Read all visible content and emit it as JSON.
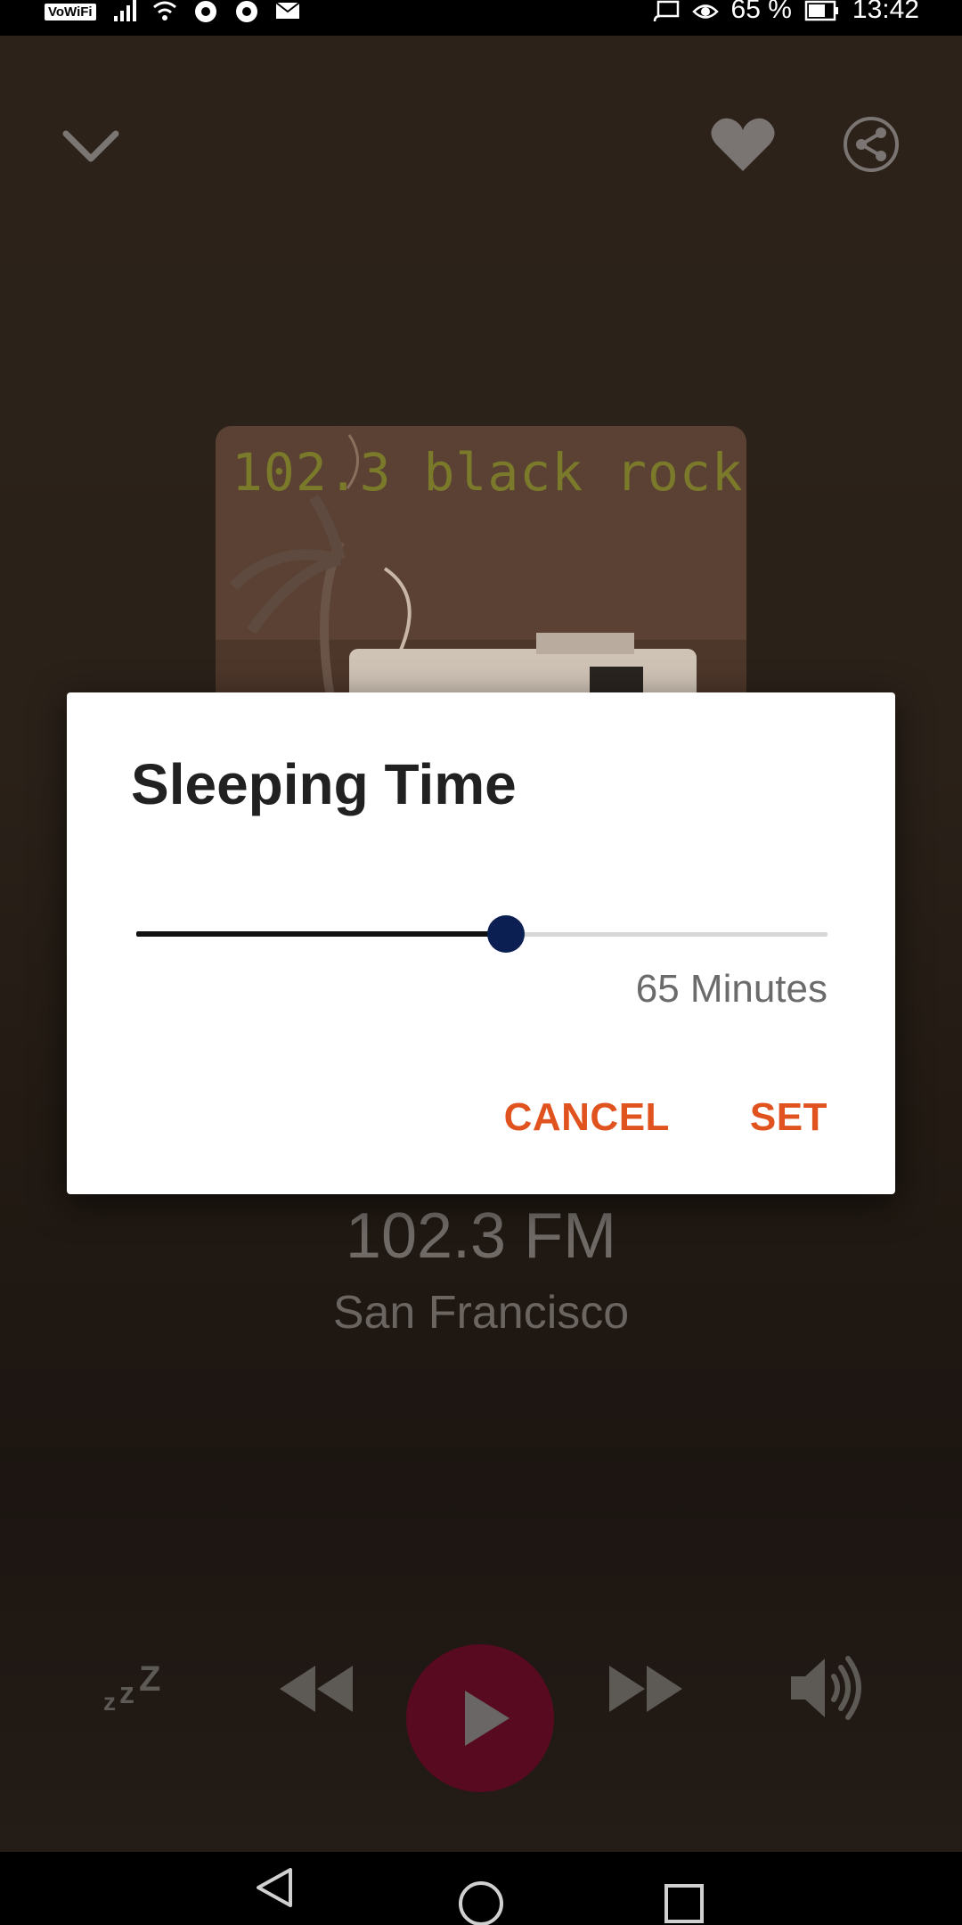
{
  "status_bar": {
    "left_badge": "VoWiFi",
    "battery_percent": "65 %",
    "time": "13:42"
  },
  "station": {
    "artwork_text": "102.3 black rock",
    "frequency": "102.3 FM",
    "city": "San Francisco"
  },
  "dialog": {
    "title": "Sleeping Time",
    "slider_fraction": 0.535,
    "value_label": "65 Minutes",
    "cancel_label": "CANCEL",
    "set_label": "SET"
  },
  "colors": {
    "accent_orange": "#e0531f",
    "slider_thumb": "#0b1f52",
    "play_button": "#570a20"
  },
  "icons": {
    "top_left": "chevron-down-icon",
    "favorite": "heart-icon",
    "share": "share-icon",
    "sleep": "sleep-zzz-icon",
    "rewind": "rewind-icon",
    "play": "play-icon",
    "forward": "fast-forward-icon",
    "volume": "volume-icon"
  }
}
